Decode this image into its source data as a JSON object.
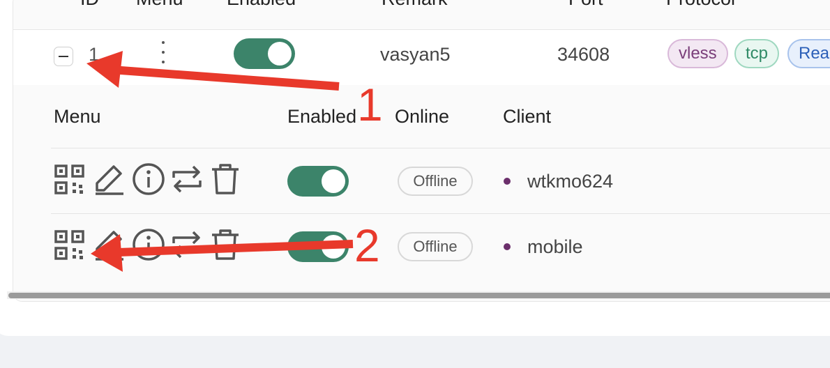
{
  "table": {
    "headers": [
      "ID",
      "Menu",
      "Enabled",
      "Remark",
      "Port",
      "Protocol"
    ],
    "row": {
      "id": "1",
      "enabled": true,
      "remark": "vasyan5",
      "port": "34608",
      "tags": [
        "vless",
        "tcp",
        "Real"
      ]
    }
  },
  "clients": {
    "headers": [
      "Menu",
      "Enabled",
      "Online",
      "Client"
    ],
    "rows": [
      {
        "enabled": true,
        "status": "Offline",
        "name": "wtkmo624"
      },
      {
        "enabled": true,
        "status": "Offline",
        "name": "mobile"
      }
    ]
  },
  "annotations": {
    "label_1": "1",
    "label_2": "2"
  },
  "colors": {
    "toggle_on": "#3c846a",
    "annotation": "#e8392b"
  }
}
